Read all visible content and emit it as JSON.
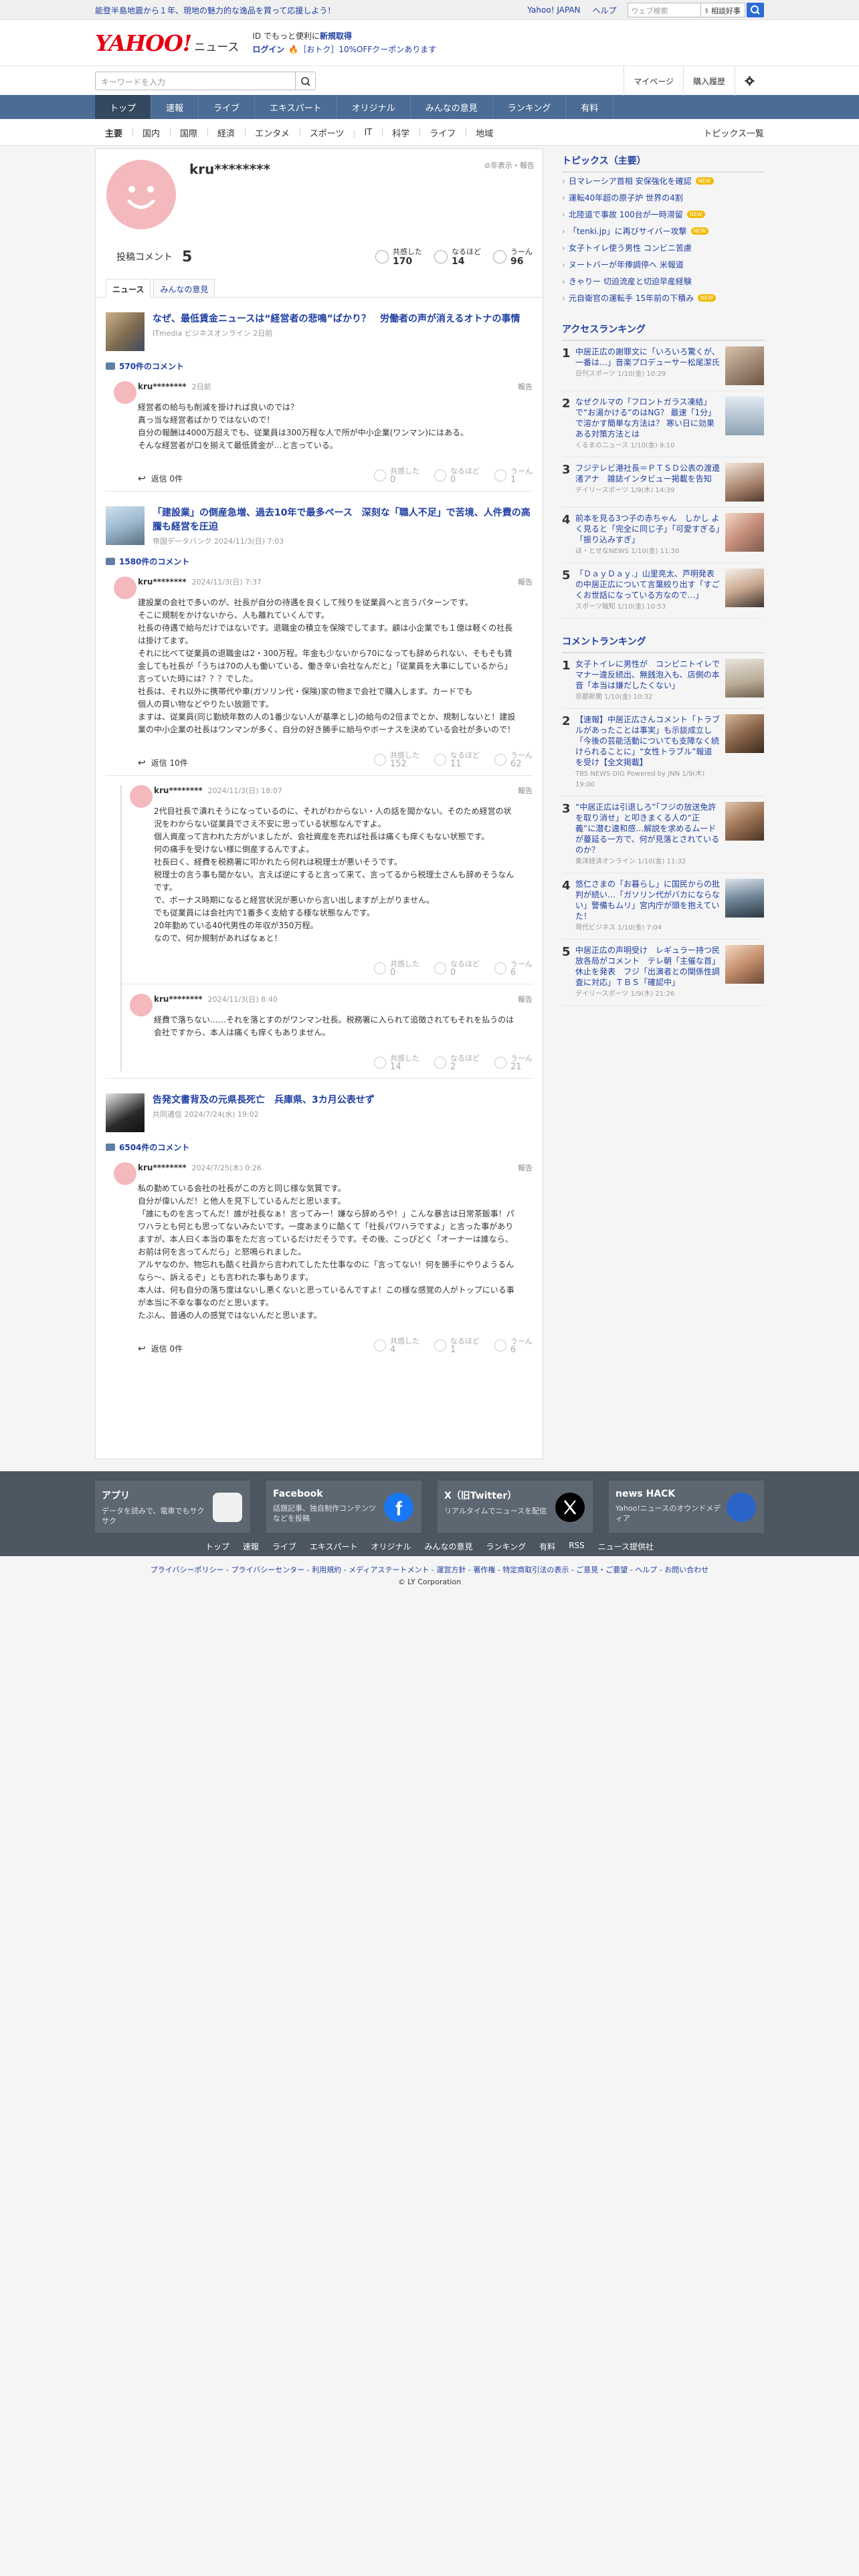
{
  "topbar": {
    "notice": "能登半島地震から１年、現地の魅力的な逸品を買って応援しよう！",
    "links": [
      "Yahoo! JAPAN",
      "ヘルプ"
    ],
    "search_placeholder": "ウェブ検索",
    "search_button": "相談好事"
  },
  "header": {
    "logo_text": "YAHOO!",
    "logo_sub": "ニュース",
    "promo_line1_prefix": "ID でもっと便利に",
    "promo_line1_bold": "新規取得",
    "promo_login": "ログイン",
    "promo_coupon": "［おトク］10%OFFクーポンあります"
  },
  "search": {
    "placeholder": "キーワードを入力",
    "right_items": [
      "マイページ",
      "購入履歴"
    ]
  },
  "nav": {
    "items": [
      "トップ",
      "速報",
      "ライブ",
      "エキスパート",
      "オリジナル",
      "みんなの意見",
      "ランキング",
      "有料"
    ],
    "sub_items": [
      "主要",
      "国内",
      "国際",
      "経済",
      "エンタメ",
      "スポーツ",
      "IT",
      "科学",
      "ライフ",
      "地域"
    ],
    "topics_all": "トピックス一覧"
  },
  "profile": {
    "username": "kru********",
    "hide_report": "非表示・報告",
    "comment_label": "投稿コメント",
    "comment_count": "5",
    "reactions": [
      {
        "label": "共感した",
        "count": "170"
      },
      {
        "label": "なるほど",
        "count": "14"
      },
      {
        "label": "うーん",
        "count": "96"
      }
    ],
    "tabs": [
      "ニュース",
      "みんなの意見"
    ]
  },
  "articles": [
    {
      "title": "なぜ、最低賃金ニュースは“経営者の悲鳴”ばかり？　労働者の声が消えるオトナの事情",
      "source": "ITmedia ビジネスオンライン 2日前",
      "comment_count": "570件のコメント",
      "comments": [
        {
          "user": "kru********",
          "date": "2日前",
          "report": "報告",
          "body": "経営者の給与も削減を掛ければ良いのでは？\n真っ当な経営者ばかりではないので！\n自分の報酬は4000万超えでも、従業員は300万程な人で所が中小企業(ワンマン)にはある。\nそんな経営者が口を揃えて最低賃金が…と言っている。",
          "reply_label": "返信 0件",
          "rx": [
            {
              "label": "共感した",
              "count": "0"
            },
            {
              "label": "なるほど",
              "count": "0"
            },
            {
              "label": "うーん",
              "count": "1"
            }
          ]
        }
      ]
    },
    {
      "title": "「建設業」の倒産急増、過去10年で最多ペース　深刻な「職人不足」で苦境、人件費の高騰も経営を圧迫",
      "source": "帝国データバンク 2024/11/3(日) 7:03",
      "comment_count": "1580件のコメント",
      "comments": [
        {
          "user": "kru********",
          "date": "2024/11/3(日) 7:37",
          "report": "報告",
          "body": "建設業の会社で多いのが、社長が自分の待遇を良くして残りを従業員へと言うパターンです。\nそこに規制をかけないから、人も離れていくんです。\n社長の待遇で給与だけではないです。退職金の積立を保険でしてます。顧は小企業でも１億は軽くの社長は掛けてます。\nそれに比べて従業員の退職金は2・300万程。年金も少ないから70になっても辞められない、そもそも賃金しても社長が「うちは70の人も働いている、働き辛い会社なんだと」「従業員を大事にしているから」言っていた時には？？？でした。\n社長は、それ以外に携帯代や車(ガソリン代・保険)家の物まで会社で購入します。カードでも\n個人の買い物などやりたい放題です。\nますは、従業員(同じ勤続年数の人の1番少ない人が基準とし)の給与の2倍までとか、規制しないと！建設業の中小企業の社長はワンマンが多く、自分の好き勝手に給与やボーナスを決めている会社が多いので！",
          "reply_label": "返信 10件",
          "rx": [
            {
              "label": "共感した",
              "count": "152"
            },
            {
              "label": "なるほど",
              "count": "11"
            },
            {
              "label": "うーん",
              "count": "62"
            }
          ]
        }
      ],
      "replies": [
        {
          "user": "kru********",
          "date": "2024/11/3(日) 18:07",
          "report": "報告",
          "body": "2代目社長で潰れそうになっているのに、それがわからない・人の話を聞かない。そのため経営の状況をわからない従業員でさえ不安に思っている状態なんですよ。\n個人資産って言われた方がいましたが、会社資産を売れば社長は痛くも痒くもない状態です。\n何の痛手を受けない様に倒産するんですよ。\n社長曰く、経費を税務署に叩かれたら何れは税理士が悪いそうです。\n税理士の言う事も聞かない。言えば逆にすると言って来て、言ってるから税理士さんも辞めそうなんです。\nで、ボーナス時期になると経営状況が悪いから言い出しますが上がりません。\nでも従業員には会社内で1番多く支給する様な状態なんです。\n20年勤めている40代男性の年収が350万程。\nなので、何か規制があればなぁと！",
          "rx": [
            {
              "label": "共感した",
              "count": "0"
            },
            {
              "label": "なるほど",
              "count": "0"
            },
            {
              "label": "うーん",
              "count": "6"
            }
          ]
        },
        {
          "user": "kru********",
          "date": "2024/11/3(日) 8:40",
          "report": "報告",
          "body": "経費で落ちない……それを落とすのがワンマン社長。税務署に入られて追徴されてもそれを払うのは会社ですから、本人は痛くも痒くもありません。",
          "rx": [
            {
              "label": "共感した",
              "count": "14"
            },
            {
              "label": "なるほど",
              "count": "2"
            },
            {
              "label": "うーん",
              "count": "21"
            }
          ]
        }
      ]
    },
    {
      "title": "告発文書背及の元県長死亡　兵庫県、3カ月公表せず",
      "source": "共同通信 2024/7/24(水) 19:02",
      "comment_count": "6504件のコメント",
      "comments": [
        {
          "user": "kru********",
          "date": "2024/7/25(木) 0:26",
          "report": "報告",
          "body": "私の勤めている会社の社長がこの方と同じ様な気質です。\n自分が偉いんだ！と他人を見下しているんだと思います。\n「誰にものを言ってんだ！誰が社長なぁ！言ってみー！嫌なら辞めろや！」こんな暴言は日常茶飯事！パワハラとも何とも思ってないみたいです。一度あまりに酷くて「社長パワハラですよ」と言った事がありますが、本人曰く本当の事をただ言っているだけだそうです。その後、こっぴどく「オーナーは誰なら、お前は何を言ってんだら」と怒鳴られました。\nアルヤなのか、物忘れも酷く社員から言われてしたた仕事なのに「言ってない！何を勝手にやりようるんなら～、訴えるぞ」とも言われた事もあります。\n本人は、何も自分の落ち度はないし悪くないと思っているんですよ！この様な感覚の人がトップにいる事が本当に不幸な事なのだと思います。\nたぶん、普通の人の感覚ではないんだと思います。",
          "reply_label": "返信 0件",
          "rx": [
            {
              "label": "共感した",
              "count": "4"
            },
            {
              "label": "なるほど",
              "count": "1"
            },
            {
              "label": "うーん",
              "count": "6"
            }
          ]
        }
      ]
    }
  ],
  "sidebar": {
    "topics_title": "トピックス（主要）",
    "topics": [
      {
        "t": "日マレーシア首相 安保強化を確認",
        "new": true
      },
      {
        "t": "運転40年超の原子炉 世界の4割",
        "new": false
      },
      {
        "t": "北陸道で事故 100台が一時滞留",
        "new": true
      },
      {
        "t": "「tenki.jp」に再びサイバー攻撃",
        "new": true
      },
      {
        "t": "女子トイレ使う男性 コンビニ苦慮",
        "new": false
      },
      {
        "t": "ヌートバーが年俸調停へ 米報道",
        "new": false
      },
      {
        "t": "きゃりー 切迫流産と切迫早産経験",
        "new": false
      },
      {
        "t": "元自衛官の運転手 15年前の下積み",
        "new": true
      }
    ],
    "new_badge": "NEW",
    "access_title": "アクセスランキング",
    "access": [
      {
        "no": "1",
        "t": "中居正広の謝罪文に「いろいろ驚くが、一番は…」音楽プロデューサー松尾潔氏",
        "src": "日刊スポーツ 1/10(金) 10:29"
      },
      {
        "no": "2",
        "t": "なぜクルマの「フロントガラス凍結」で“お湯かける”のはNG？ 最速「1分」で溶かす簡単な方法は？ 寒い日に効果ある対策方法とは",
        "src": "くるまのニュース 1/10(金) 9:10"
      },
      {
        "no": "3",
        "t": "フジテレビ港社長＝ＰＴＳＤ公表の渡邊渚アナ　雑誌インタビュー掲載を告知",
        "src": "デイリースポーツ 1/9(木) 14:39"
      },
      {
        "no": "4",
        "t": "前本を見る3つ子の赤ちゃん　しかし よく見ると「完全に同じ子」「可愛すぎる」「振り込みすぎ」",
        "src": "ほ・とせなNEWS 1/10(金) 11:30"
      },
      {
        "no": "5",
        "t": "「ＤａｙＤａｙ.」山里亮太、芦明発表の中居正広について言葉絞り出す「すごくお世話になっている方なので…」",
        "src": "スポーツ報知 1/10(金) 10:53"
      }
    ],
    "comment_title": "コメントランキング",
    "comment_rank": [
      {
        "no": "1",
        "t": "女子トイレに男性が　コンビニトイレでマナー違反続出、無銭泡入も、店側の本音「本当は嫌だしたくない」",
        "src": "京都新聞 1/10(金) 10:32"
      },
      {
        "no": "2",
        "t": "【速報】中居正広さんコメント「トラブルがあったことは事実」も示談成立し「今後の芸能活動についても支障なく続けられることに」“女性トラブル”報道を受け【全文掲載】",
        "src": "TBS NEWS DIG Powered by JNN 1/9(木) 19:00"
      },
      {
        "no": "3",
        "t": "“中居正広は引退しろ”「フジの放送免許を取り消せ」と叩きまくる人の“正義”に潜む違和感…解説を求めるムードが蔓延る一方で、何が見落とされているのか？",
        "src": "東洋経済オンライン 1/10(金) 11:32"
      },
      {
        "no": "4",
        "t": "悠仁さまの「お暮らし」に国民からの批判が続い…「ガソリン代がバカにならない」警備もムリ」宮内庁が頭を抱えていた！",
        "src": "現代ビジネス 1/10(金) 7:04"
      },
      {
        "no": "5",
        "t": "中居正広の声明受け　レギュラー持つ民放各局がコメント　テレ朝「主催な首」休止を発表　フジ「出演者との関係性調査に対応」ＴＢＳ「確認中」",
        "src": "デイリースポーツ 1/9(木) 21:26"
      }
    ]
  },
  "footer": {
    "apps": [
      {
        "title": "アプリ",
        "desc": "データを読みで、電車でもサクサク"
      },
      {
        "title": "Facebook",
        "desc": "話題記事、独自制作コンテンツなどを投稿"
      },
      {
        "title": "X（旧Twitter）",
        "desc": "リアルタイムでニュースを配信"
      },
      {
        "title": "news HACK",
        "desc": "Yahoo!ニュースのオウンドメディア"
      }
    ],
    "links": [
      "トップ",
      "速報",
      "ライブ",
      "エキスパート",
      "オリジナル",
      "みんなの意見",
      "ランキング",
      "有料",
      "RSS",
      "ニュース提供社"
    ],
    "bottom_links": "プライバシーポリシー - プライバシーセンター - 利用規約 - メディアステートメント - 運営方針 - 著作権 - 特定商取引法の表示 - ご意見・ご要望 - ヘルプ - お問い合わせ",
    "copyright": "© LY Corporation"
  }
}
